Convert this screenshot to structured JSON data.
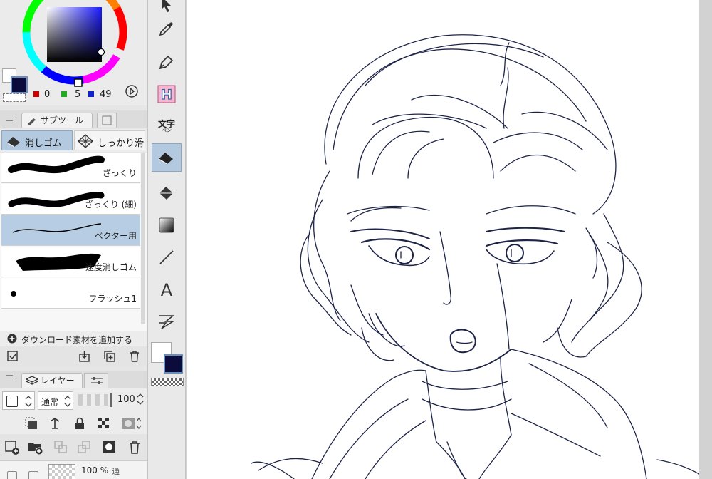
{
  "color_panel": {
    "values": [
      "0",
      "5",
      "49"
    ],
    "main_color": "#0b0b3c",
    "sub_color": "#ffffff"
  },
  "subtool_panel": {
    "tab_label": "サブツール",
    "groups": [
      "消しゴム",
      "しっかり滑"
    ],
    "brushes": [
      {
        "label": "ざっくり"
      },
      {
        "label": "ざっくり (細)"
      },
      {
        "label": "ベクター用"
      },
      {
        "label": "速度消しゴム"
      },
      {
        "label": "フラッシュ1"
      }
    ],
    "add_download_label": "ダウンロード素材を追加する"
  },
  "layer_panel": {
    "tab_label": "レイヤー",
    "blend_mode": "通常",
    "opacity": "100",
    "layer_row": {
      "opacity_label": "100 %",
      "mode_short": "通"
    }
  },
  "toolbar": {
    "text_tool_label": "文字",
    "text_tool_sub": "ペン",
    "selected_tool": "eraser"
  }
}
